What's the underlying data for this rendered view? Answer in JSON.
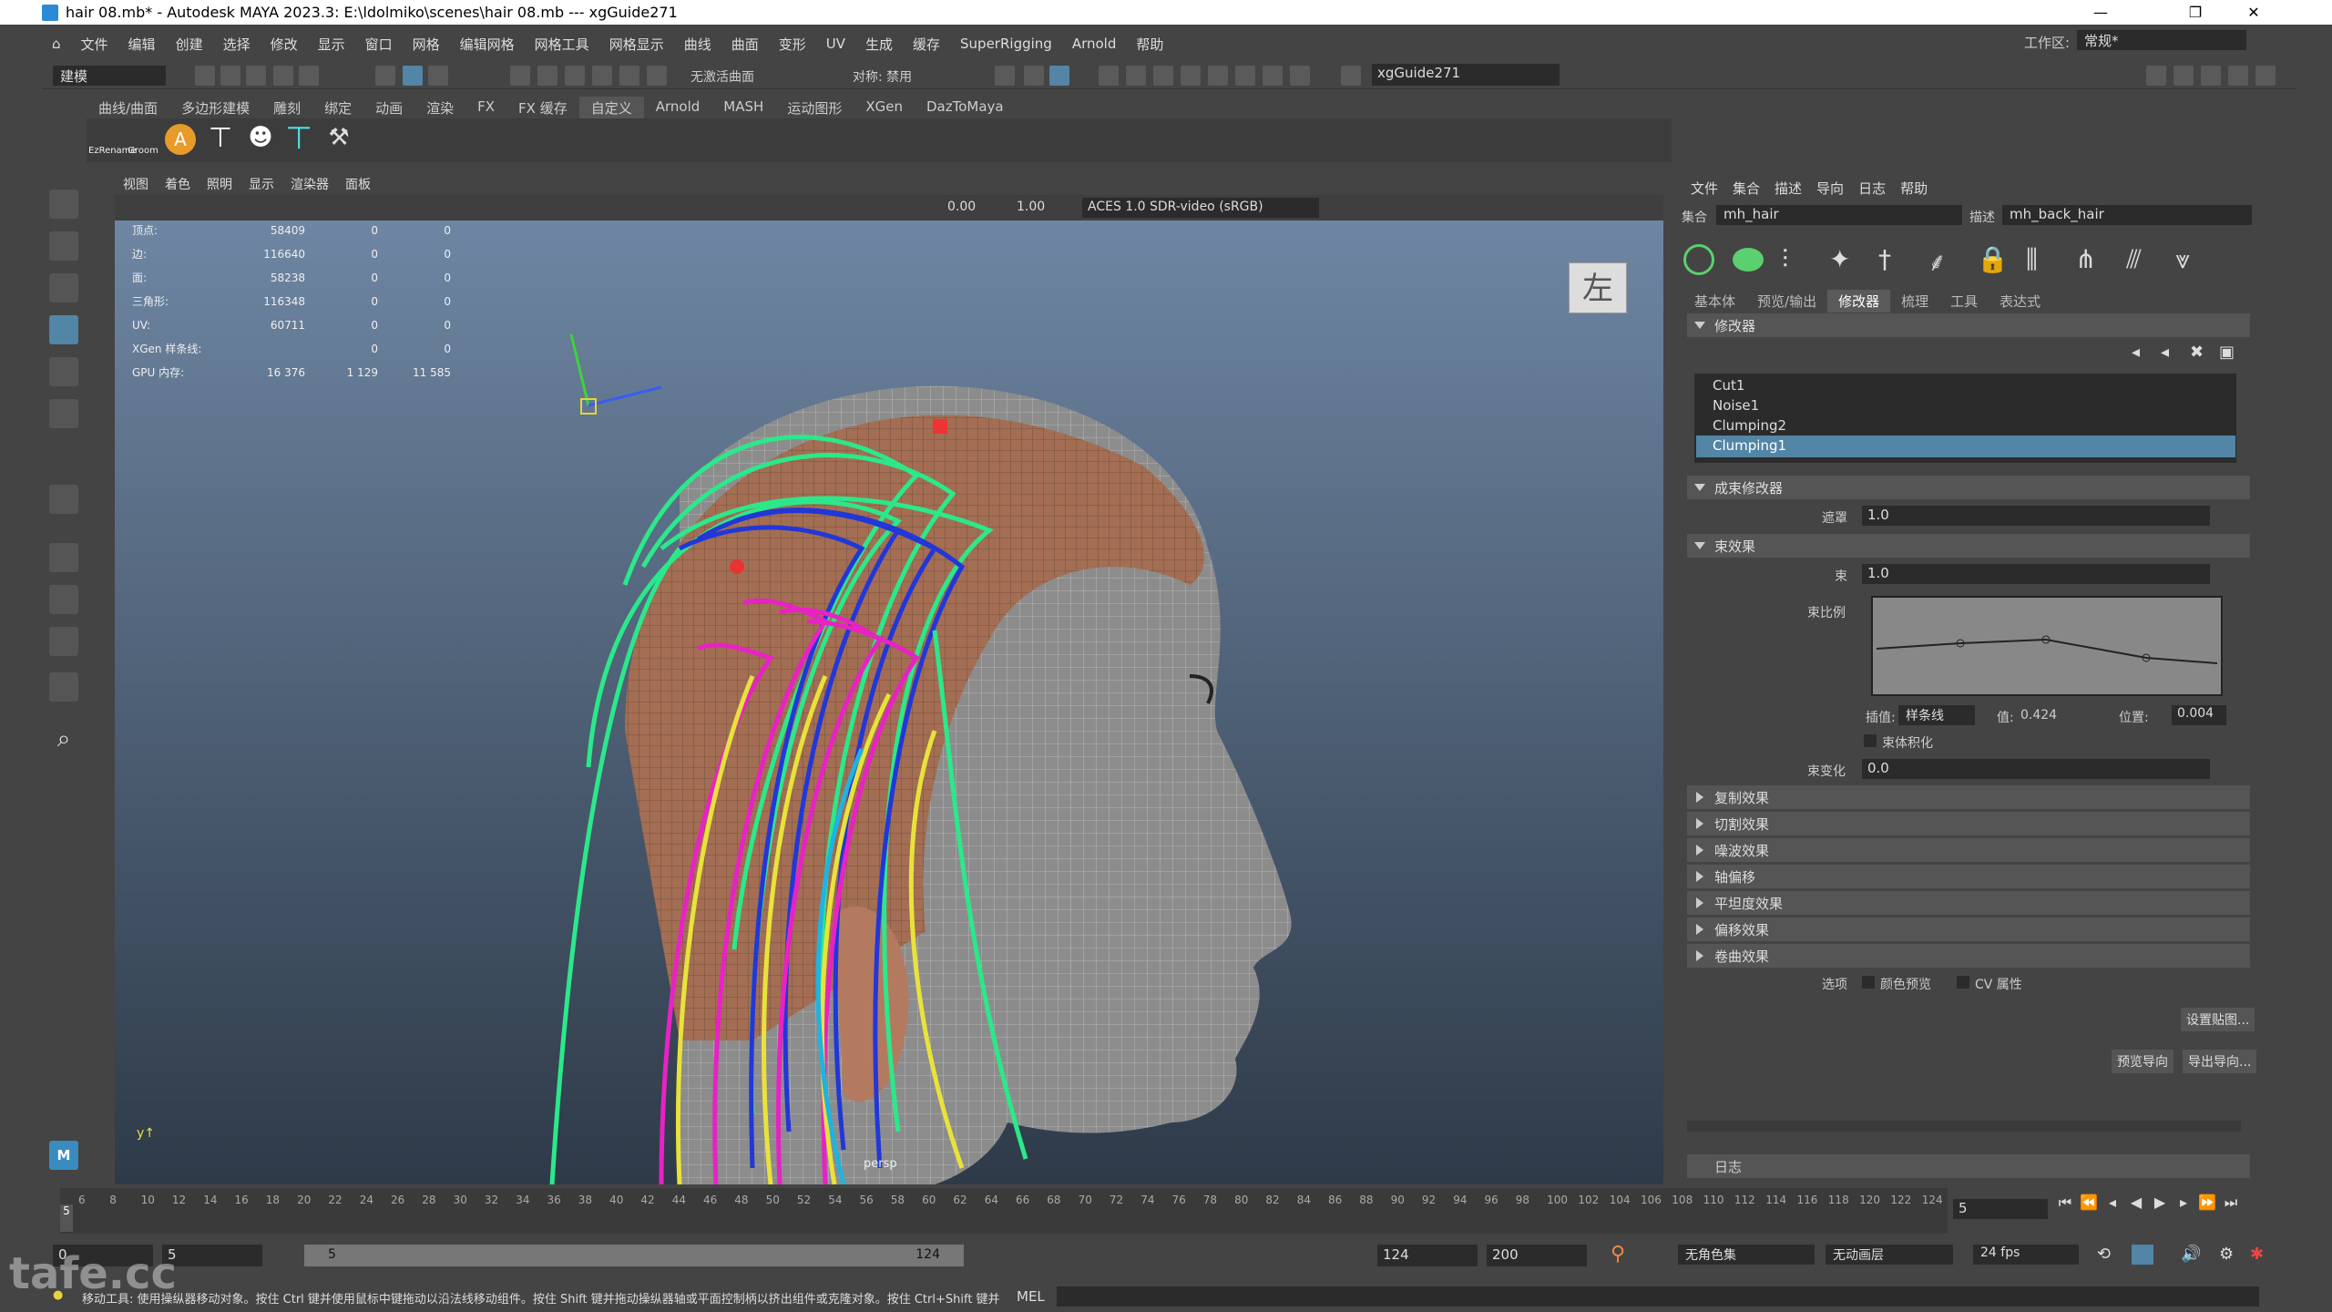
{
  "window": {
    "title": "hair 08.mb* - Autodesk MAYA 2023.3: E:\\ldolmiko\\scenes\\hair 08.mb   ---   xgGuide271"
  },
  "menubar": [
    "文件",
    "编辑",
    "创建",
    "选择",
    "修改",
    "显示",
    "窗口",
    "网格",
    "编辑网格",
    "网格工具",
    "网格显示",
    "曲线",
    "曲面",
    "变形",
    "UV",
    "生成",
    "缓存",
    "SuperRigging",
    "Arnold",
    "帮助"
  ],
  "workspace": {
    "label": "工作区:",
    "value": "常规*"
  },
  "statusline": {
    "mode": "建模",
    "live_surface": "无激活曲面",
    "symmetry": "对称: 禁用",
    "object_field": "xgGuide271"
  },
  "shelf_tabs": [
    "曲线/曲面",
    "多边形建模",
    "雕刻",
    "绑定",
    "动画",
    "渲染",
    "FX",
    "FX 缓存",
    "自定义",
    "Arnold",
    "MASH",
    "运动图形",
    "XGen",
    "DazToMaya"
  ],
  "shelf_active": "自定义",
  "shelf_icons": [
    "EzRename",
    "Groom"
  ],
  "viewport": {
    "menu": [
      "视图",
      "着色",
      "照明",
      "显示",
      "渲染器",
      "面板"
    ],
    "exposure": "0.00",
    "gamma": "1.00",
    "colorspace": "ACES 1.0 SDR-video (sRGB)",
    "hud": [
      {
        "label": "顶点:",
        "v1": "58409",
        "v2": "0",
        "v3": "0"
      },
      {
        "label": "边:",
        "v1": "116640",
        "v2": "0",
        "v3": "0"
      },
      {
        "label": "面:",
        "v1": "58238",
        "v2": "0",
        "v3": "0"
      },
      {
        "label": "三角形:",
        "v1": "116348",
        "v2": "0",
        "v3": "0"
      },
      {
        "label": "UV:",
        "v1": "60711",
        "v2": "0",
        "v3": "0"
      },
      {
        "label": "XGen 样条线:",
        "v1": "",
        "v2": "0",
        "v3": "0"
      },
      {
        "label": "GPU 内存:",
        "v1": "16 376",
        "v2": "1 129",
        "v3": "11 585"
      }
    ],
    "viewcube": "左",
    "camera": "persp"
  },
  "xgen": {
    "menu": [
      "文件",
      "集合",
      "描述",
      "导向",
      "日志",
      "帮助"
    ],
    "collection_label": "集合",
    "collection": "mh_hair",
    "description_label": "描述",
    "description": "mh_back_hair",
    "tabs": [
      "基本体",
      "预览/输出",
      "修改器",
      "梳理",
      "工具",
      "表达式"
    ],
    "active_tab": "修改器",
    "modifiers_header": "修改器",
    "modifiers": [
      "Cut1",
      "Noise1",
      "Clumping2",
      "Clumping1"
    ],
    "selected_modifier": "Clumping1",
    "clump_header": "成束修改器",
    "mask_label": "遮罩",
    "mask_value": "1.0",
    "clump_effect_header": "束效果",
    "clump_label": "束",
    "clump_value": "1.0",
    "scale_label": "束比例",
    "interp_label": "插值:",
    "interp_value": "样条线",
    "value_label": "值:",
    "value_value": "0.424",
    "pos_label": "位置:",
    "pos_value": "0.004",
    "flatten_label": "束体积化",
    "variation_label": "束变化",
    "variation_value": "0.0",
    "collapsed": [
      "复制效果",
      "切割效果",
      "噪波效果",
      "轴偏移",
      "平坦度效果",
      "偏移效果",
      "卷曲效果"
    ],
    "options_label": "选项",
    "color_preview": "颜色预览",
    "cv_attr": "CV 属性",
    "set_map": "设置贴图...",
    "preview_guides": "预览导向",
    "export_guides": "导出导向...",
    "log": "日志"
  },
  "timeline": {
    "ticks": [
      "6",
      "8",
      "10",
      "12",
      "14",
      "16",
      "18",
      "20",
      "22",
      "24",
      "26",
      "28",
      "30",
      "32",
      "34",
      "36",
      "38",
      "40",
      "42",
      "44",
      "46",
      "48",
      "50",
      "52",
      "54",
      "56",
      "58",
      "60",
      "62",
      "64",
      "66",
      "68",
      "70",
      "72",
      "74",
      "76",
      "78",
      "80",
      "82",
      "84",
      "86",
      "88",
      "90",
      "92",
      "94",
      "96",
      "98",
      "100",
      "102",
      "104",
      "106",
      "108",
      "110",
      "112",
      "114",
      "116",
      "118",
      "120",
      "122",
      "124"
    ],
    "current": "5",
    "current_field": "5"
  },
  "range": {
    "start": "0",
    "anim_start": "5",
    "slider_start": "5",
    "slider_end": "124",
    "anim_end": "124",
    "end": "200",
    "charset": "无角色集",
    "anim_layer": "无动画层",
    "fps": "24 fps"
  },
  "helpline": {
    "text": "移动工具: 使用操纵器移动对象。按住 Ctrl 键并使用鼠标中键拖动以沿法线移动组件。按住 Shift 键并拖动操纵器轴或平面控制柄以挤出组件或克隆对象。按住 Ctrl+Shift 键并",
    "mel": "MEL"
  },
  "watermark": "tafe.cc"
}
